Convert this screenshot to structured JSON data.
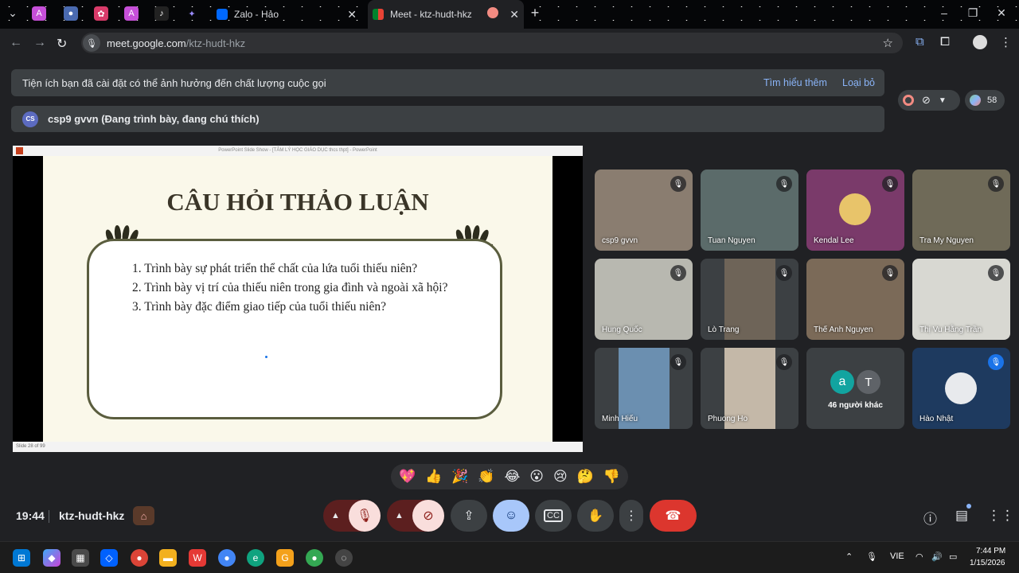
{
  "browser": {
    "tabs": [
      {
        "label": "Zalo - Hảo",
        "close": "✕"
      },
      {
        "label": "Meet - ktz-hudt-hkz",
        "close": "✕"
      }
    ],
    "new_tab": "+",
    "url_host": "meet.google.com",
    "url_path": "/ktz-hudt-hkz"
  },
  "banner": {
    "text": "Tiện ích bạn đã cài đặt có thể ảnh hưởng đến chất lượng cuộc gọi",
    "learn_more": "Tìm hiểu thêm",
    "remove": "Loại bỏ"
  },
  "presenter": {
    "initials": "CS",
    "label": "csp9 gvvn (Đang trình bày, đang chú thích)"
  },
  "participants_count": "58",
  "slide": {
    "window_title": "PowerPoint Slide Show - [TÂM LÝ HỌC GIÁO DỤC thcs thpt] - PowerPoint",
    "title": "CÂU HỎI THẢO LUẬN",
    "items": [
      "1.   Trình bày sự phát triển thể chất của lứa tuổi thiếu niên?",
      "2.    Trình bày vị trí của thiếu niên trong gia đình và ngoài xã hội?",
      "3.   Trình bày đặc điểm giao tiếp của tuổi thiếu niên?"
    ],
    "footer": "Slide 28 of 99"
  },
  "participants": [
    {
      "name": "csp9 gvvn",
      "color": "#8a7d70"
    },
    {
      "name": "Tuan Nguyen",
      "color": "#5b6b6a"
    },
    {
      "name": "Kendal Lee",
      "color": "#7a3a6a"
    },
    {
      "name": "Tra My Nguyen",
      "color": "#6f6a58"
    },
    {
      "name": "Hung Quốc",
      "color": "#b8b8b0"
    },
    {
      "name": "Lò Trang",
      "color": "#6e6458"
    },
    {
      "name": "Thế Anh Nguyen",
      "color": "#7b6a58"
    },
    {
      "name": "Thị Vu Hằng Trần",
      "color": "#d8d8d2"
    },
    {
      "name": "Minh Hiếu",
      "color": "#6b8fb0"
    },
    {
      "name": "Phuong Ho",
      "color": "#c4b8a8"
    },
    {
      "name": "46 người khác",
      "color": "#3c4043",
      "avatars": [
        "a",
        "T"
      ]
    },
    {
      "name": "Hào Nhật",
      "color": "#1e3a5f"
    }
  ],
  "reactions": [
    "💖",
    "👍",
    "🎉",
    "👏",
    "😂",
    "😮",
    "😢",
    "🤔",
    "👎"
  ],
  "controls": {
    "time": "19:44",
    "meeting_code": "ktz-hudt-hkz"
  },
  "taskbar": {
    "lang": "VIE",
    "time": "7:44 PM",
    "date": "1/15/2026"
  }
}
